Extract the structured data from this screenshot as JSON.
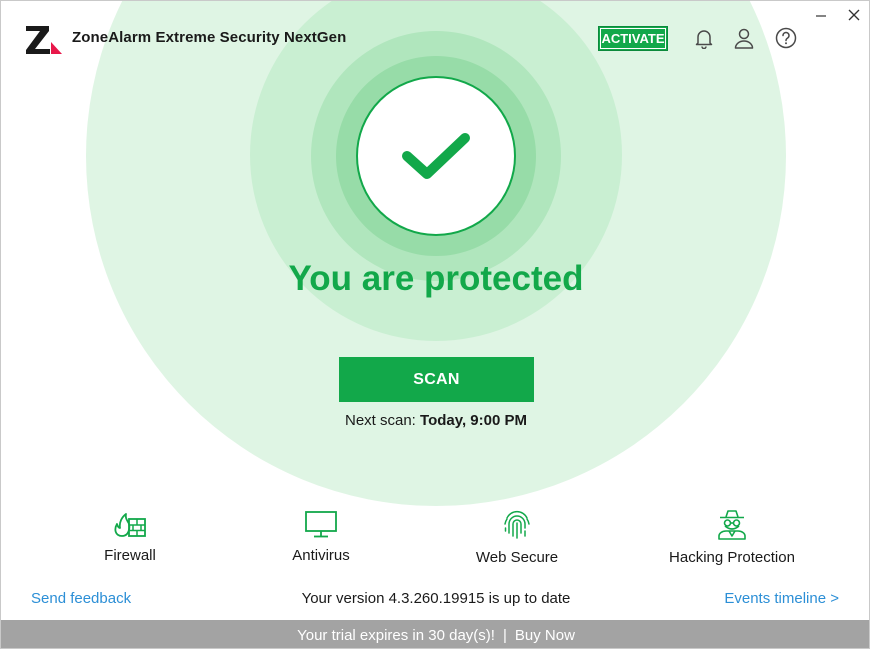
{
  "window": {
    "title": "ZoneAlarm Extreme Security NextGen",
    "minimize": "–",
    "close": "×"
  },
  "header": {
    "activate_label": "ACTIVATE",
    "icons": [
      "bell-icon",
      "user-icon",
      "help-icon"
    ]
  },
  "status": {
    "headline": "You are protected",
    "icon": "checkmark-icon"
  },
  "scan": {
    "button_label": "SCAN",
    "next_scan_prefix": "Next scan:",
    "next_scan_value": "Today, 9:00 PM"
  },
  "features": [
    {
      "label": "Firewall",
      "icon": "firewall-icon"
    },
    {
      "label": "Antivirus",
      "icon": "monitor-icon"
    },
    {
      "label": "Web Secure",
      "icon": "fingerprint-icon"
    },
    {
      "label": "Hacking Protection",
      "icon": "spy-icon"
    }
  ],
  "footer": {
    "send_feedback": "Send feedback",
    "version_text": "Your version 4.3.260.19915 is up to date",
    "events_timeline": "Events timeline >"
  },
  "trial": {
    "message": "Your trial expires in 30 day(s)!",
    "separator": "|",
    "buy_now": "Buy Now"
  },
  "colors": {
    "accent": "#12a84a",
    "link": "#2c8fd6",
    "trial_bar": "#a3a3a3"
  }
}
